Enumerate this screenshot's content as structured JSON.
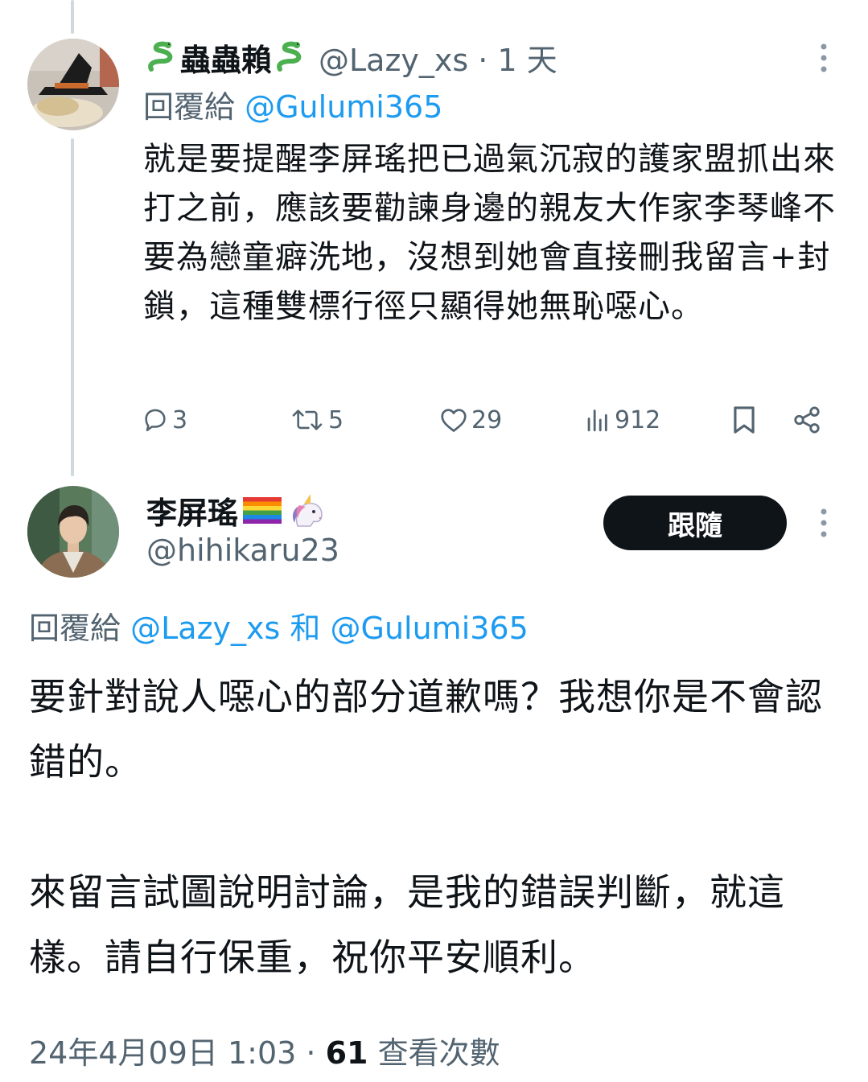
{
  "reply_tweet": {
    "display_name": "蟲蟲賴",
    "handle": "@Lazy_xs",
    "time": "1 天",
    "separator": "·",
    "replying_label": "回覆給",
    "replying_mention": "@Gulumi365",
    "body": "就是要提醒李屏瑤把已過氣沉寂的護家盟抓出來打之前，應該要勸諫身邊的親友大作家李琴峰不要為戀童癖洗地，沒想到她會直接刪我留言+封鎖，這種雙標行徑只顯得她無恥噁心。",
    "replies": "3",
    "reposts": "5",
    "likes": "29",
    "views": "912"
  },
  "main_tweet": {
    "display_name": "李屏瑤",
    "handle": "@hihikaru23",
    "follow_label": "跟隨",
    "replying_label": "回覆給",
    "replying_mention_1": "@Lazy_xs",
    "replying_and": "和",
    "replying_mention_2": "@Gulumi365",
    "body_paragraph_1": "要針對說人噁心的部分道歉嗎？我想你是不會認錯的。",
    "body_paragraph_2": "來留言試圖說明討論，是我的錯誤判斷，就這樣。請自行保重，祝你平安順利。",
    "timestamp": "24年4月09日 1:03",
    "separator": "·",
    "views_count": "61",
    "views_label": "查看次數"
  },
  "icons": {
    "reply": "speech-bubble-icon",
    "repost": "repost-arrows-icon",
    "like": "heart-icon",
    "views": "bar-chart-icon",
    "bookmark": "bookmark-icon",
    "share": "share-icon",
    "more": "vertical-ellipsis-icon",
    "name_emoji_1": "snake-emoji",
    "name_emoji_2": "rainbow-flag-emoji",
    "name_emoji_3": "unicorn-emoji"
  },
  "colors": {
    "link": "#1d9bf0",
    "secondary_text": "#536471",
    "primary_text": "#0f1419",
    "follow_button": "#0f1419",
    "thread_line": "#cfd9de"
  }
}
